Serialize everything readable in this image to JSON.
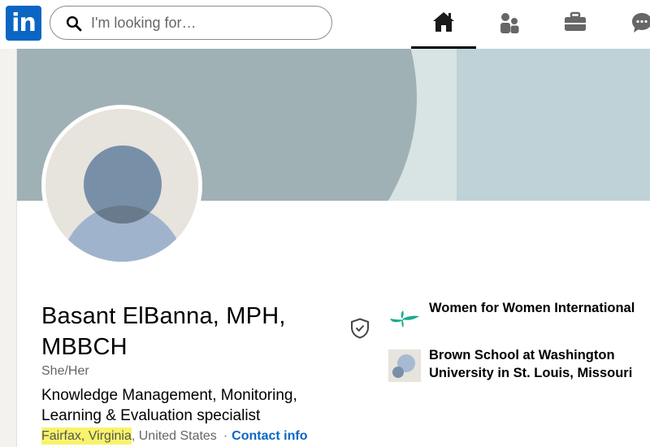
{
  "nav": {
    "logo_text": "in",
    "search_placeholder": "I'm looking for…",
    "items": [
      {
        "name": "home",
        "icon": "home-icon",
        "active": true
      },
      {
        "name": "my-network",
        "icon": "people-icon",
        "active": false
      },
      {
        "name": "jobs",
        "icon": "briefcase-icon",
        "active": false
      },
      {
        "name": "messaging",
        "icon": "chat-icon",
        "active": false
      }
    ]
  },
  "profile": {
    "name": "Basant ElBanna, MPH, MBBCH",
    "pronouns": "She/Her",
    "headline": "Knowledge Management, Monitoring, Learning & Evaluation specialist",
    "location_highlighted": "Fairfax, Virginia",
    "location_rest": ", United States",
    "separator": "·",
    "contact_label": "Contact info"
  },
  "organizations": [
    {
      "name": "Women for Women International",
      "logo": "women-for-women-logo"
    },
    {
      "name": "Brown School at Washington University in St. Louis, Missouri",
      "logo": "brown-school-logo"
    }
  ],
  "colors": {
    "brand": "#0a66c2",
    "highlight": "#f7f36b",
    "banner_dark": "#9fb1b5",
    "banner_light": "#bfd2d8"
  }
}
